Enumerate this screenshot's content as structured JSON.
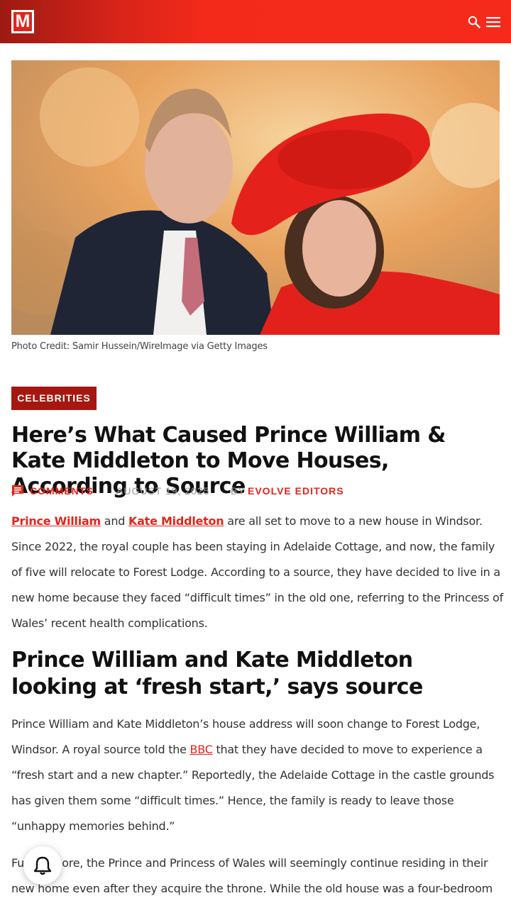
{
  "header": {
    "logo_text": "M",
    "icons": [
      "search-icon",
      "menu-icon"
    ],
    "brand_color": "#f52a1a"
  },
  "hero": {
    "credit": "Photo Credit: Samir Hussein/WireImage via Getty Images"
  },
  "article": {
    "category": "CELEBRITIES",
    "title": "Here’s What Caused Prince William & Kate Middleton to Move Houses, According to Source",
    "meta": {
      "comments_label": "COMMENTS",
      "date": "AUGUST 19, 2025",
      "by_label": "BY",
      "author": "EVOLVE EDITORS"
    },
    "para1": {
      "link1": "Prince William",
      "and": " and ",
      "link2": "Kate Middleton",
      "text": " are all set to move to a new house in Windsor. Since 2022, the royal couple has been staying in Adelaide Cottage, and now, the family of five will relocate to Forest Lodge. According to a source, they have decided to live in a new home because they faced “difficult times” in the old one, referring to the Princess of Wales’ recent health complications."
    },
    "subhead": "Prince William and Kate Middleton looking at ‘fresh start,’ says source",
    "para2": {
      "before": "Prince William and Kate Middleton’s house address will soon change to Forest Lodge, Windsor. A royal source told the ",
      "link": "BBC",
      "after": " that they have decided to move to experience a “fresh start and a new chapter.” Reportedly, the Adelaide Cottage in the castle grounds has given them some “difficult times.” Hence, the family is ready to leave those “unhappy memories behind.”"
    },
    "para3": "Furthermore, the Prince and Princess of Wales will seemingly continue residing in their new home even after they acquire the throne. While the old house was a four-bedroom"
  },
  "notification": {
    "icon": "bell-icon"
  }
}
